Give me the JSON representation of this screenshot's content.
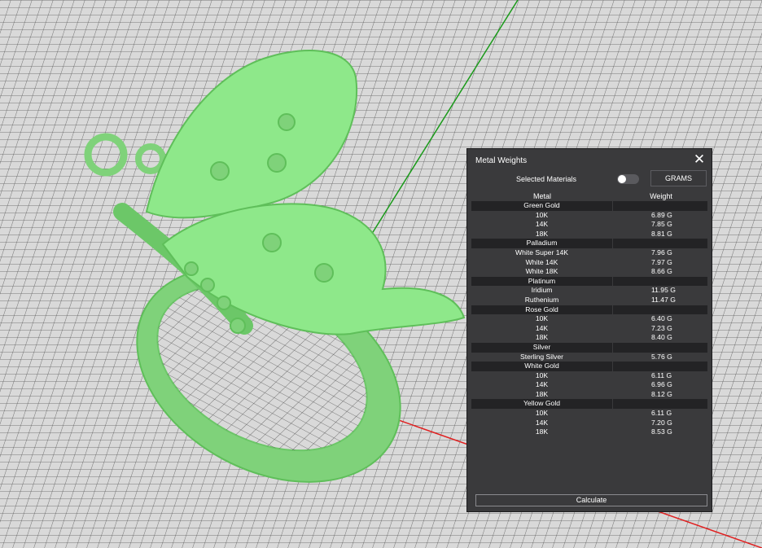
{
  "panel": {
    "title": "Metal Weights",
    "close_icon": "close-icon",
    "selected_materials_label": "Selected Materials",
    "toggle_on": false,
    "unit_button_label": "GRAMS",
    "columns": {
      "metal": "Metal",
      "weight": "Weight"
    },
    "groups": [
      {
        "name": "Green Gold",
        "items": [
          {
            "name": "10K",
            "weight": "6.89 G"
          },
          {
            "name": "14K",
            "weight": "7.85 G"
          },
          {
            "name": "18K",
            "weight": "8.81 G"
          }
        ]
      },
      {
        "name": "Palladium",
        "items": [
          {
            "name": "White Super 14K",
            "weight": "7.96 G"
          },
          {
            "name": "White 14K",
            "weight": "7.97 G"
          },
          {
            "name": "White 18K",
            "weight": "8.66 G"
          }
        ]
      },
      {
        "name": "Platinum",
        "items": [
          {
            "name": "Iridium",
            "weight": "11.95 G"
          },
          {
            "name": "Ruthenium",
            "weight": "11.47 G"
          }
        ]
      },
      {
        "name": "Rose Gold",
        "items": [
          {
            "name": "10K",
            "weight": "6.40 G"
          },
          {
            "name": "14K",
            "weight": "7.23 G"
          },
          {
            "name": "18K",
            "weight": "8.40 G"
          }
        ]
      },
      {
        "name": "Silver",
        "items": [
          {
            "name": "Sterling Silver",
            "weight": "5.76 G"
          }
        ]
      },
      {
        "name": "White Gold",
        "items": [
          {
            "name": "10K",
            "weight": "6.11 G"
          },
          {
            "name": "14K",
            "weight": "6.96 G"
          },
          {
            "name": "18K",
            "weight": "8.12 G"
          }
        ]
      },
      {
        "name": "Yellow Gold",
        "items": [
          {
            "name": "10K",
            "weight": "6.11 G"
          },
          {
            "name": "14K",
            "weight": "7.20 G"
          },
          {
            "name": "18K",
            "weight": "8.53 G"
          }
        ]
      }
    ],
    "calculate_label": "Calculate"
  },
  "viewport": {
    "model": "butterfly ring",
    "model_color": "#8ee88a",
    "grid_color": "#555555",
    "background_color": "#d9d9d9",
    "x_axis_color": "#e02020",
    "y_axis_color": "#1a9a1a"
  }
}
